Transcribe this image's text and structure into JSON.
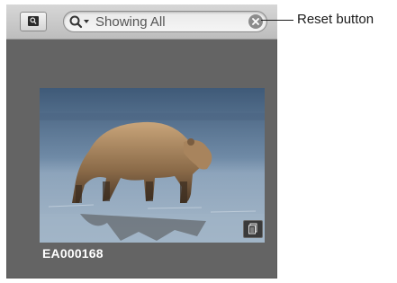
{
  "toolbar": {
    "viewer_button_icon": "magnifier-icon",
    "search": {
      "menu_icon": "search-menu-icon",
      "value": "Showing All",
      "reset_icon": "clear-icon"
    }
  },
  "browser": {
    "items": [
      {
        "caption": "EA000168",
        "badge_icon": "version-stack-icon"
      }
    ]
  },
  "callout": {
    "label": "Reset button"
  },
  "colors": {
    "panel_background": "#646464",
    "toolbar_background": "#c9c9c9",
    "caption_text": "#ffffff"
  }
}
